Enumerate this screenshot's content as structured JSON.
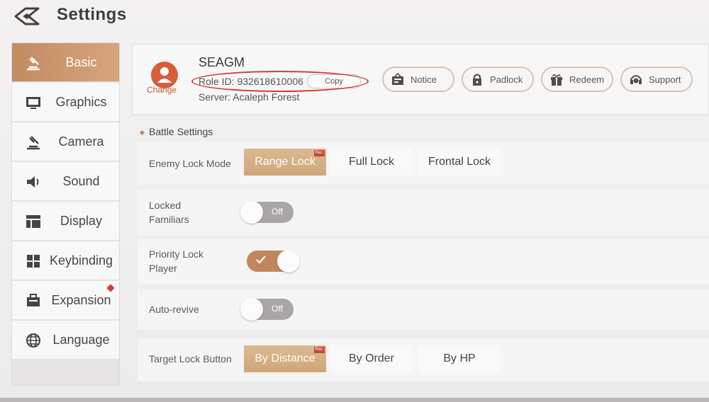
{
  "header": {
    "title": "Settings",
    "back_icon": "back-arrow-icon"
  },
  "sidebar": {
    "items": [
      {
        "label": "Basic",
        "icon": "gavel-icon",
        "active": true
      },
      {
        "label": "Graphics",
        "icon": "monitor-icon"
      },
      {
        "label": "Camera",
        "icon": "gavel-icon"
      },
      {
        "label": "Sound",
        "icon": "speaker-icon"
      },
      {
        "label": "Display",
        "icon": "layout-icon"
      },
      {
        "label": "Keybinding",
        "icon": "grid-icon"
      },
      {
        "label": "Expansion",
        "icon": "briefcase-icon",
        "badge": "red-dot"
      },
      {
        "label": "Language",
        "icon": "globe-icon"
      }
    ]
  },
  "profile": {
    "change_label": "Change",
    "name": "SEAGM",
    "role_id": "Role ID: 932618610006",
    "copy_label": "Copy",
    "server": "Server:   Acaleph Forest",
    "buttons": [
      {
        "label": "Notice",
        "icon": "notice-board-icon"
      },
      {
        "label": "Padlock",
        "icon": "padlock-icon"
      },
      {
        "label": "Redeem",
        "icon": "gift-icon"
      },
      {
        "label": "Support",
        "icon": "headset-icon"
      }
    ]
  },
  "battle": {
    "title": "Battle Settings",
    "enemy_lock": {
      "label": "Enemy Lock Mode",
      "options": [
        "Range Lock",
        "Full Lock",
        "Frontal Lock"
      ],
      "selected": "Range Lock",
      "tag": "Rec."
    },
    "locked_familiars": {
      "label_line1": "Locked",
      "label_line2": "Familiars",
      "state": "Off"
    },
    "priority_lock": {
      "label_line1": "Priority Lock",
      "label_line2": "Player",
      "state": "on"
    },
    "auto_revive": {
      "label": "Auto-revive",
      "state": "Off"
    },
    "target_lock": {
      "label": "Target Lock Button",
      "options": [
        "By Distance",
        "By Order",
        "By HP"
      ],
      "selected": "By Distance",
      "tag": "Rec."
    }
  },
  "colors": {
    "accent": "#c28b62",
    "highlight": "#d63a3a",
    "avatar": "#d85d3a"
  }
}
